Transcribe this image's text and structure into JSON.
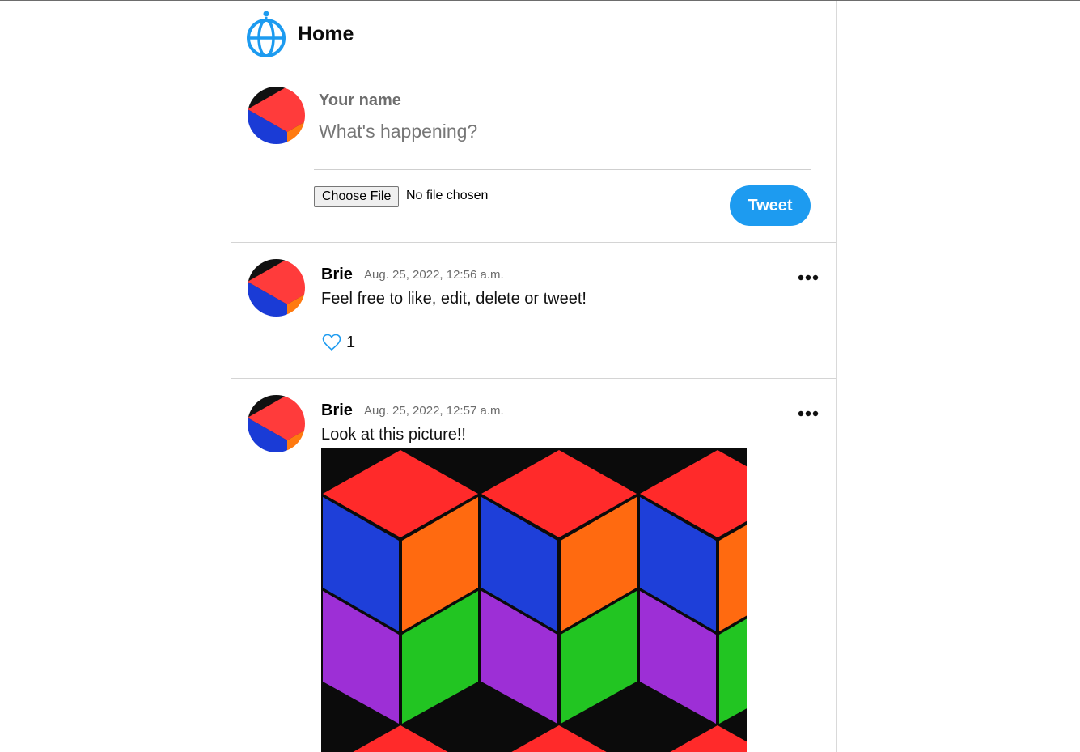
{
  "header": {
    "title": "Home",
    "logo_icon": "globe-logo-icon",
    "accent_color": "#1d9bf0"
  },
  "composer": {
    "name_placeholder": "Your name",
    "content_placeholder": "What's happening?",
    "choose_file_label": "Choose File",
    "file_status": "No file chosen",
    "tweet_button_label": "Tweet"
  },
  "tweets": [
    {
      "author": "Brie",
      "timestamp": "Aug. 25, 2022, 12:56 a.m.",
      "text": "Feel free to like, edit, delete or tweet!",
      "like_count": "1"
    },
    {
      "author": "Brie",
      "timestamp": "Aug. 25, 2022, 12:57 a.m.",
      "text": "Look at this picture!!"
    }
  ]
}
